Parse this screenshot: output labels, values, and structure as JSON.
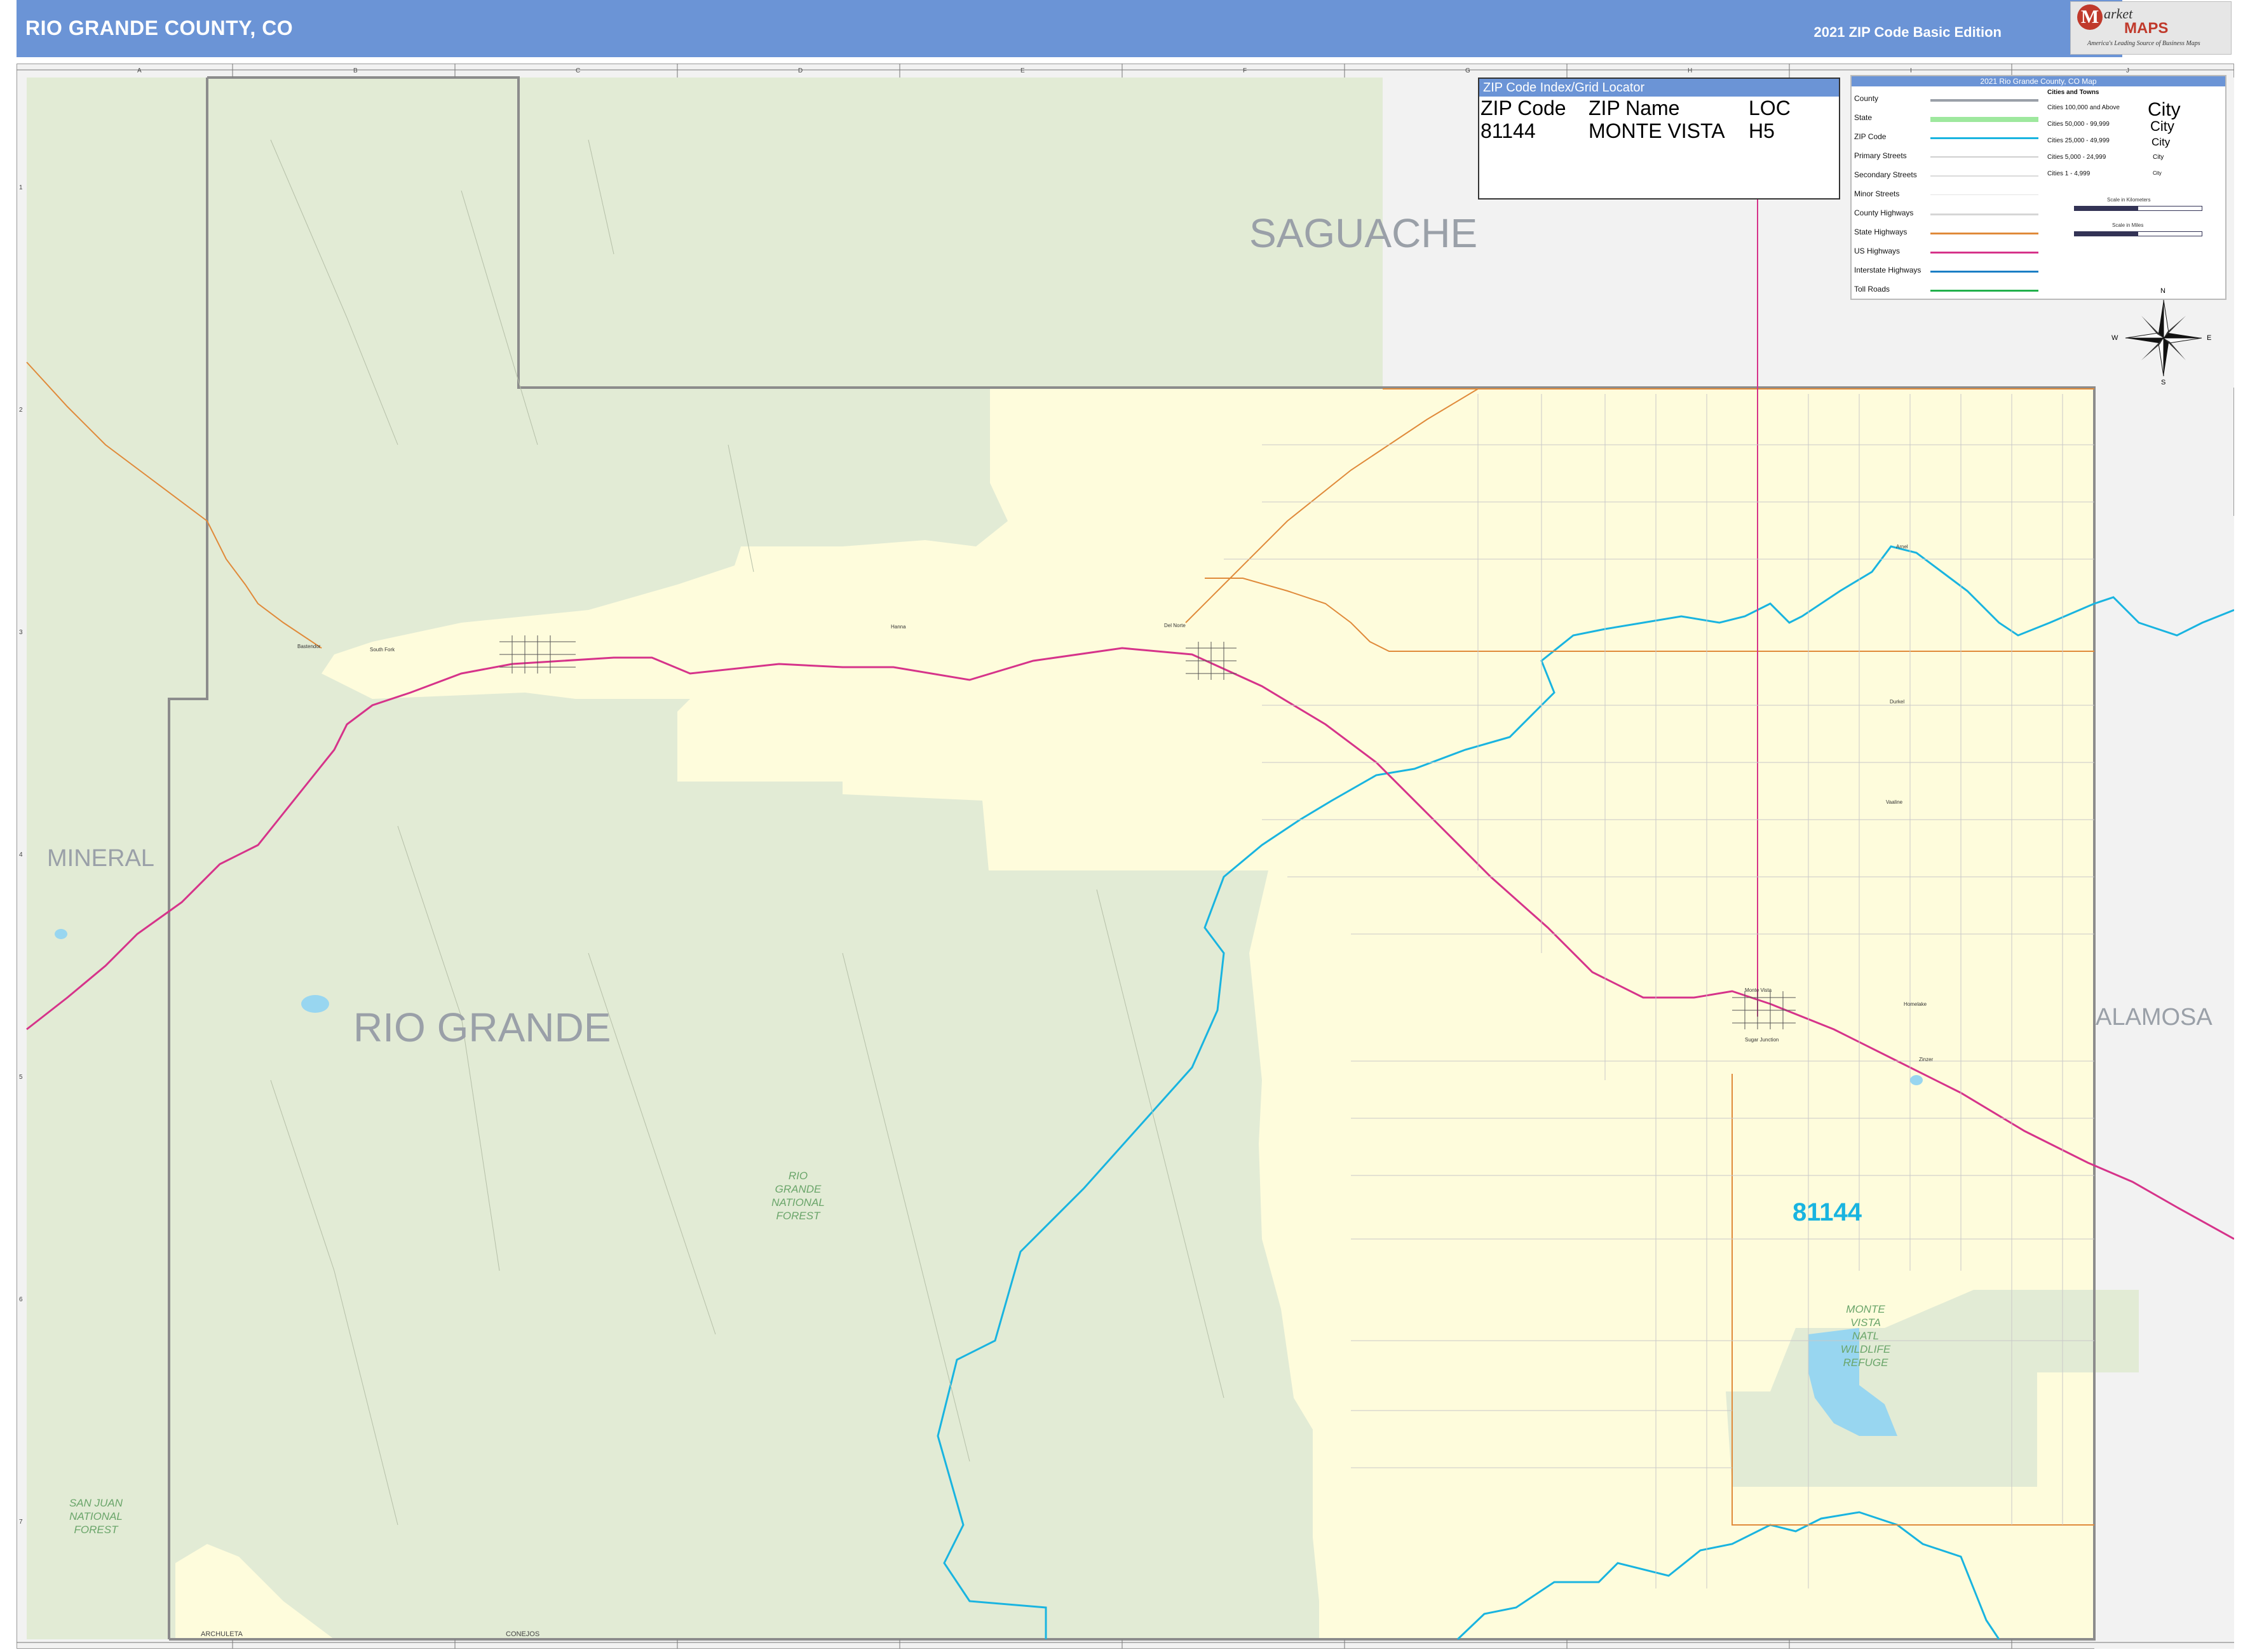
{
  "header": {
    "title": "RIO GRANDE COUNTY, CO",
    "edition": "2021 ZIP Code Basic Edition"
  },
  "logo": {
    "brand_initial": "M",
    "brand_rest": "arket",
    "brand_maps": "MAPS",
    "tagline": "America's Leading Source of Business Maps"
  },
  "counties": {
    "main": "RIO GRANDE",
    "north": "SAGUACHE",
    "west": "MINERAL",
    "east": "ALAMOSA",
    "south_left": "ARCHULETA",
    "south_right": "CONEJOS"
  },
  "forests": {
    "rio_grande": "RIO\nGRANDE\nNATIONAL\nFOREST",
    "san_juan": "SAN JUAN\nNATIONAL\nFOREST",
    "refuge": "MONTE\nVISTA\nNATL\nWILDLIFE\nREFUGE"
  },
  "places": {
    "south_fork": "South Fork",
    "bastendor": "Bastendor",
    "hanna": "Hanna",
    "del_norte": "Del Norte",
    "monte_vista": "Monte Vista",
    "homelake": "Homelake",
    "sugar_junction": "Sugar Junction",
    "zinzer": "Zinzer",
    "arnel": "Arnel",
    "durkel": "Durkel",
    "vaaline": "Vaaline"
  },
  "zip_index": {
    "header": "ZIP Code Index/Grid Locator",
    "columns": [
      "ZIP Code",
      "ZIP Name",
      "LOC"
    ],
    "rows": [
      [
        "81144",
        "MONTE VISTA",
        "H5"
      ]
    ]
  },
  "zip_labels": {
    "main": "81144"
  },
  "legend": {
    "header": "2021 Rio Grande County, CO Map",
    "items": [
      "County",
      "State",
      "ZIP Code",
      "Primary Streets",
      "Secondary Streets",
      "Minor Streets",
      "County Highways",
      "State Highways",
      "US Highways",
      "Interstate Highways",
      "Toll Roads"
    ],
    "cities_header": "Cities and Towns",
    "cities": [
      "Cities 100,000 and Above",
      "Cities 50,000 - 99,999",
      "Cities 25,000 - 49,999",
      "Cities 5,000 - 24,999",
      "Cities 1 - 4,999"
    ],
    "city_samples": [
      "City",
      "City",
      "City",
      "City",
      "City"
    ],
    "scale_km": "Scale in Kilometers",
    "scale_mi": "Scale in Miles"
  },
  "compass": {
    "n": "N",
    "s": "S",
    "e": "E",
    "w": "W"
  },
  "grid": {
    "columns": [
      "A",
      "B",
      "C",
      "D",
      "E",
      "F",
      "G",
      "H",
      "I",
      "J"
    ],
    "rows": [
      "1",
      "2",
      "3",
      "4",
      "5",
      "6",
      "7"
    ]
  },
  "colors": {
    "header": "#6b94d6",
    "forest": "#e2ebd5",
    "county_fill": "#fefcdc",
    "outside": "#f2f2f2",
    "zip_line": "#19b4e0",
    "us_highway": "#d6338a",
    "state_highway": "#e08a3a"
  }
}
